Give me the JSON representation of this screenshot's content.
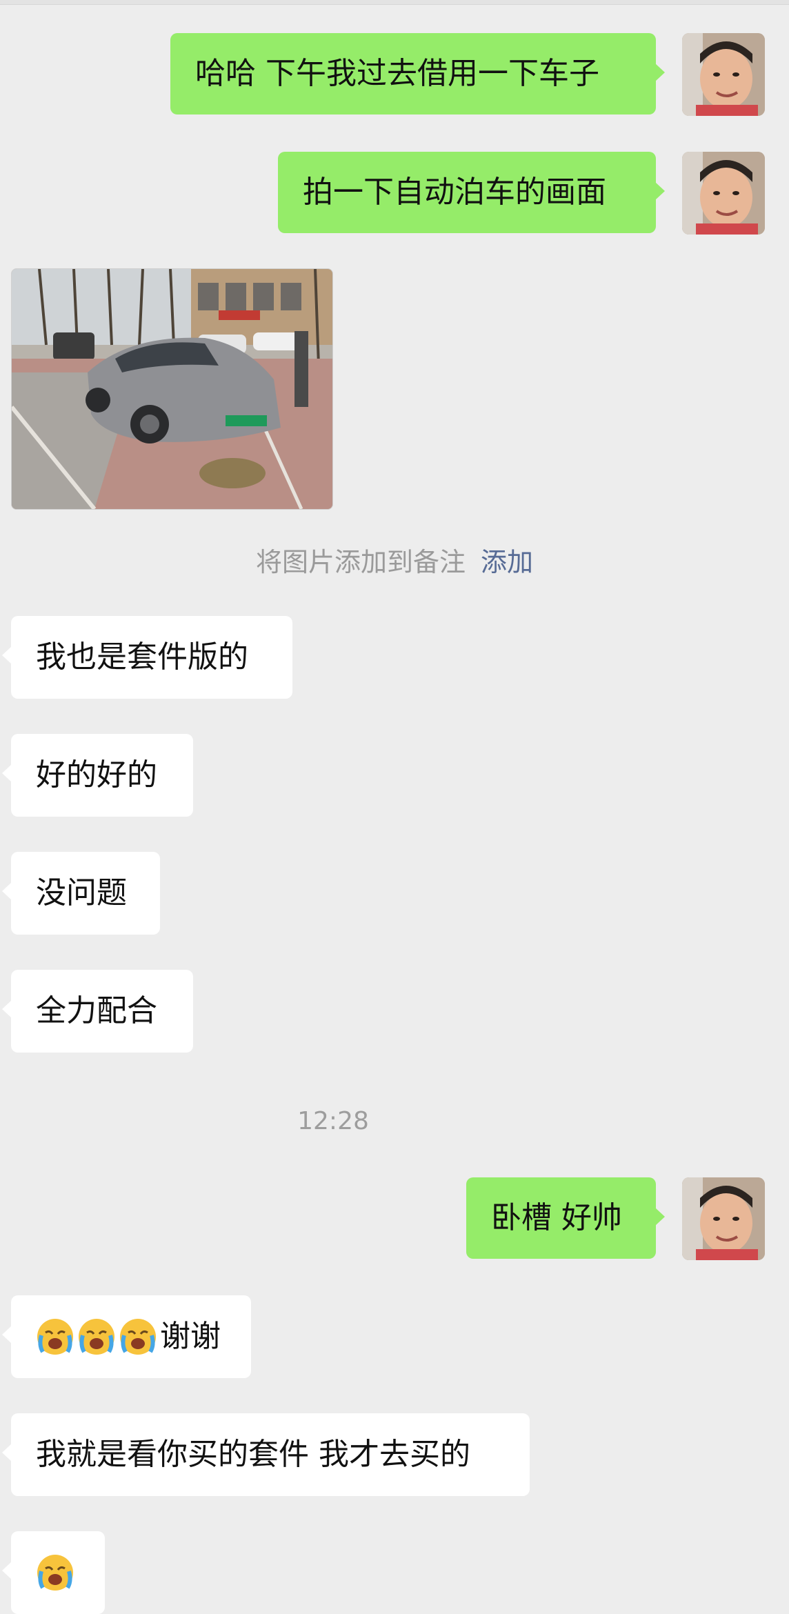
{
  "messages": {
    "m1": "哈哈 下午我过去借用一下车子",
    "m2": "拍一下自动泊车的画面",
    "m3": "我也是套件版的",
    "m4": "好的好的",
    "m5": "没问题",
    "m6": "全力配合",
    "m7": "卧槽 好帅",
    "m8_text": "谢谢",
    "m9": "我就是看你买的套件 我才去买的"
  },
  "note_hint": {
    "text": "将图片添加到备注",
    "action": "添加"
  },
  "timestamp": "12:28",
  "icons": {
    "cry_laugh": "loudly-crying-emoji",
    "avatar": "user-avatar-photo",
    "photo": "parked-car-photo"
  },
  "colors": {
    "background": "#ededed",
    "outgoing_bubble": "#95ec69",
    "incoming_bubble": "#ffffff",
    "link": "#576b95"
  }
}
